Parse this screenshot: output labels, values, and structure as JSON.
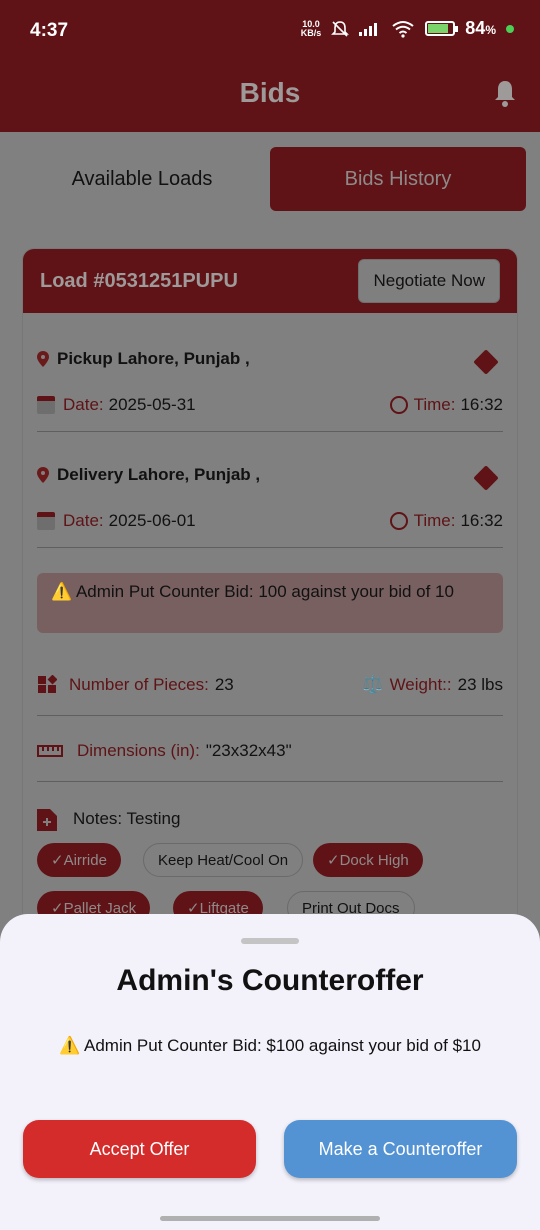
{
  "status": {
    "time": "4:37",
    "net_speed_top": "10.0",
    "net_speed_bottom": "KB/s",
    "battery": "84",
    "battery_unit": "%",
    "battery_level": 0.84
  },
  "app_bar": {
    "title": "Bids",
    "bell_icon": "bell-icon"
  },
  "tabs": [
    {
      "label": "Available Loads",
      "active": false
    },
    {
      "label": "Bids History",
      "active": true
    }
  ],
  "card": {
    "load_id": "Load #0531251PUPU",
    "negotiate_label": "Negotiate Now",
    "pickup": {
      "title": "Pickup Lahore, Punjab ,",
      "date_label": "Date:",
      "date": "2025-05-31",
      "time_label": "Time:",
      "time": "16:32"
    },
    "delivery": {
      "title": "Delivery Lahore, Punjab ,",
      "date_label": "Date:",
      "date": "2025-06-01",
      "time_label": "Time:",
      "time": "16:32"
    },
    "notice": "Admin Put Counter Bid: 100 against your bid of 10",
    "pieces_label": "Number of Pieces:",
    "pieces": "23",
    "weight_label": "Weight::",
    "weight": "23 lbs",
    "dimensions_label": "Dimensions (in):",
    "dimensions": "\"23x32x43\"",
    "notes": "Notes: Testing",
    "chips": [
      {
        "label": "Airride",
        "on": true
      },
      {
        "label": "Keep Heat/Cool On",
        "on": false
      },
      {
        "label": "Dock High",
        "on": true
      },
      {
        "label": "Pallet Jack",
        "on": true
      },
      {
        "label": "Liftgate",
        "on": true
      },
      {
        "label": "Print Out Docs",
        "on": false
      }
    ]
  },
  "sheet": {
    "title": "Admin's Counteroffer",
    "message": "Admin Put Counter Bid: $100 against your bid of $10",
    "accept_label": "Accept Offer",
    "counter_label": "Make a Counteroffer"
  },
  "colors": {
    "primary": "#d42b2b",
    "secondary": "#5393d4",
    "dim_bar": "#5f1316"
  }
}
